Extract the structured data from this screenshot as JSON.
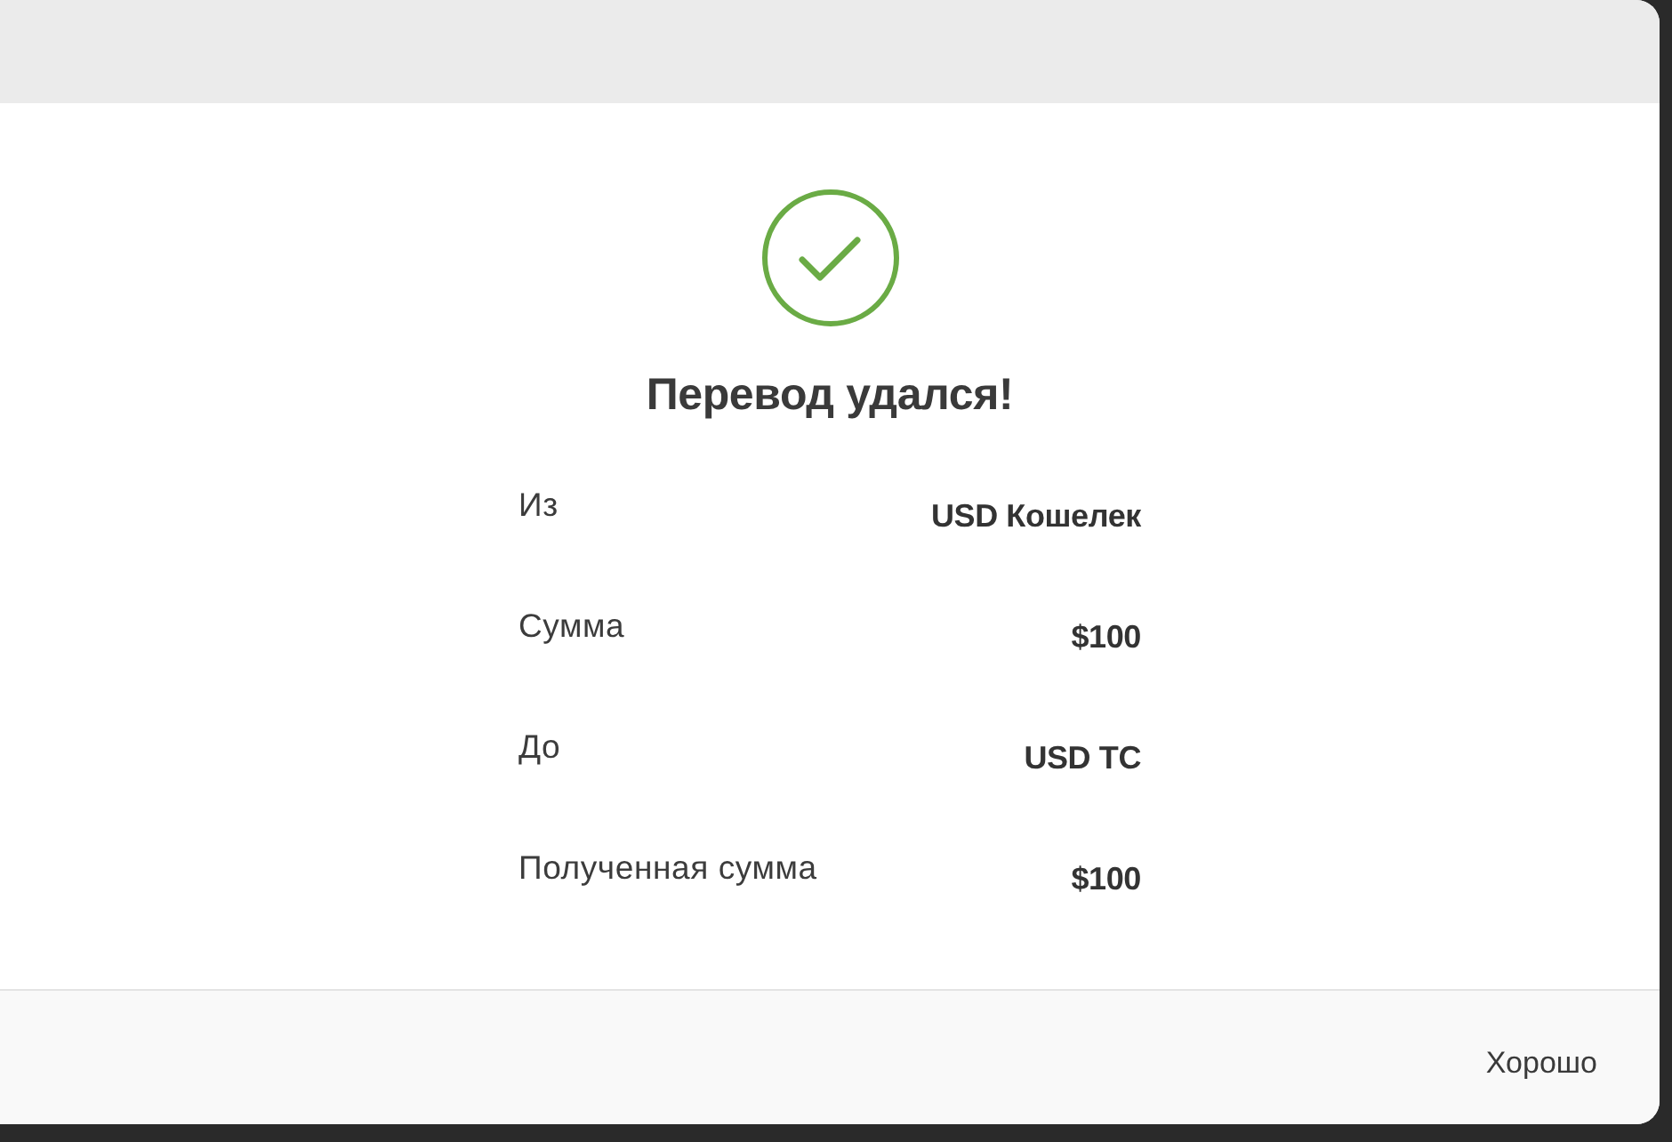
{
  "dialog": {
    "title": "Перевод удался!",
    "details": [
      {
        "label": "Из",
        "value": "USD Кошелек"
      },
      {
        "label": "Сумма",
        "value": "$100"
      },
      {
        "label": "До",
        "value": "USD TC"
      },
      {
        "label": "Полученная сумма",
        "value": "$100"
      }
    ],
    "buttons": [
      "Хорошо"
    ]
  }
}
